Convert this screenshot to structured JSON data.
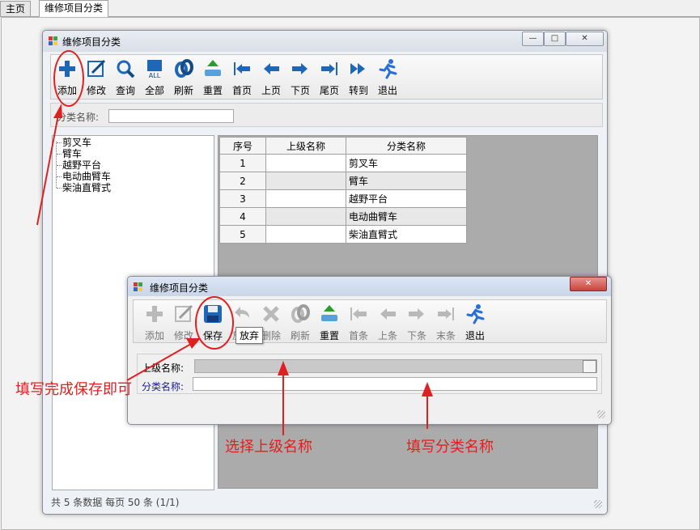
{
  "tabs": [
    {
      "label": "主页"
    },
    {
      "label": "维修项目分类"
    }
  ],
  "main_window": {
    "title": "维修项目分类",
    "controls": {
      "minimize": "—",
      "maximize": "□",
      "close": "✕"
    },
    "toolbar": [
      {
        "label": "添加",
        "icon": "plus-icon"
      },
      {
        "label": "修改",
        "icon": "edit-icon"
      },
      {
        "label": "查询",
        "icon": "search-icon"
      },
      {
        "label": "全部",
        "icon": "all-icon"
      },
      {
        "label": "刷新",
        "icon": "refresh-icon"
      },
      {
        "label": "重置",
        "icon": "reset-icon"
      },
      {
        "label": "首页",
        "icon": "first-page-icon"
      },
      {
        "label": "上页",
        "icon": "prev-page-icon"
      },
      {
        "label": "下页",
        "icon": "next-page-icon"
      },
      {
        "label": "尾页",
        "icon": "last-page-icon"
      },
      {
        "label": "转到",
        "icon": "goto-icon"
      },
      {
        "label": "退出",
        "icon": "exit-runner-icon"
      }
    ],
    "search": {
      "label": "分类名称:",
      "value": ""
    },
    "tree": [
      "剪叉车",
      "臂车",
      "越野平台",
      "电动曲臂车",
      "柴油直臂式"
    ],
    "table": {
      "headers": [
        "序号",
        "上级名称",
        "分类名称"
      ],
      "rows": [
        {
          "no": "1",
          "parent": "",
          "name": "剪叉车"
        },
        {
          "no": "2",
          "parent": "",
          "name": "臂车"
        },
        {
          "no": "3",
          "parent": "",
          "name": "越野平台"
        },
        {
          "no": "4",
          "parent": "",
          "name": "电动曲臂车"
        },
        {
          "no": "5",
          "parent": "",
          "name": "柴油直臂式"
        }
      ]
    },
    "status": "共 5 条数据  每页 50 条 (1/1)"
  },
  "dialog": {
    "title": "维修项目分类",
    "close": "✕",
    "toolbar": [
      {
        "label": "添加",
        "icon": "plus-icon",
        "enabled": false
      },
      {
        "label": "修改",
        "icon": "edit-icon",
        "enabled": false
      },
      {
        "label": "保存",
        "icon": "save-icon",
        "enabled": true
      },
      {
        "label": "放弃",
        "icon": "undo-icon",
        "enabled": false
      },
      {
        "label": "删除",
        "icon": "delete-icon",
        "enabled": false
      },
      {
        "label": "刷新",
        "icon": "refresh-icon",
        "enabled": false
      },
      {
        "label": "重置",
        "icon": "reset-icon",
        "enabled": true
      },
      {
        "label": "首条",
        "icon": "first-icon",
        "enabled": false
      },
      {
        "label": "上条",
        "icon": "prev-icon",
        "enabled": false
      },
      {
        "label": "下条",
        "icon": "next-icon",
        "enabled": false
      },
      {
        "label": "末条",
        "icon": "last-icon",
        "enabled": false
      },
      {
        "label": "退出",
        "icon": "exit-runner-icon",
        "enabled": true
      }
    ],
    "tooltip": "放弃",
    "fields": {
      "parent_label": "上级名称:",
      "parent_value": "",
      "name_label": "分类名称:",
      "name_value": ""
    }
  },
  "annotations": {
    "fill_save": "填写完成保存即可",
    "select_parent": "选择上级名称",
    "fill_name": "填写分类名称"
  },
  "colors": {
    "annotation": "#e02020",
    "title_bar": "#d9dfe8",
    "close_button": "#c9443d"
  }
}
